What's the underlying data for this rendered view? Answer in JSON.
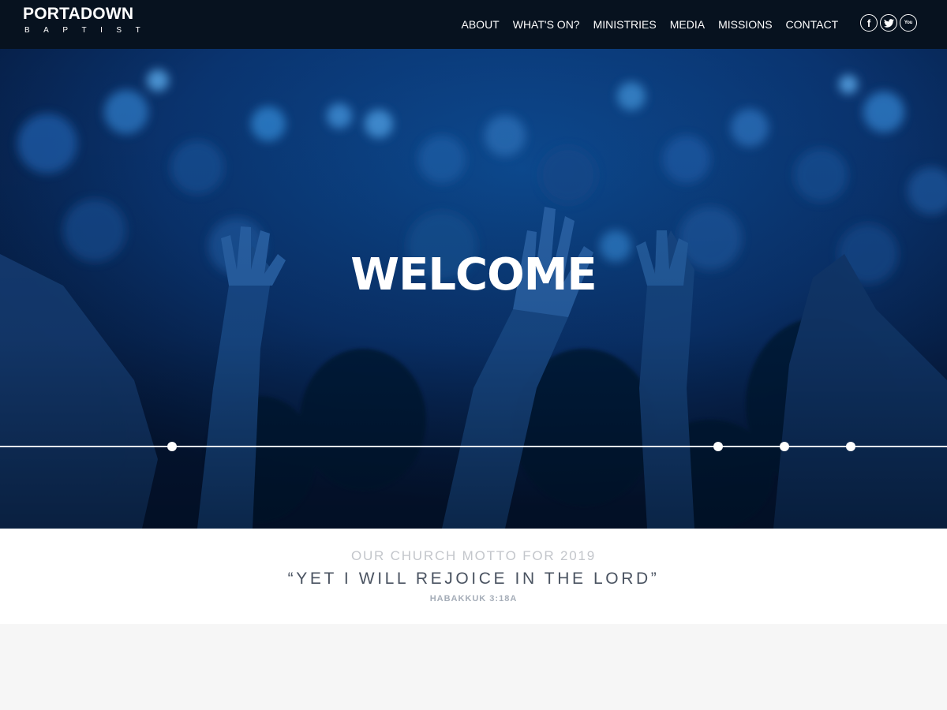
{
  "header": {
    "logo_main": "PORTADOWN",
    "logo_sub": "BAPTIST",
    "nav": [
      {
        "label": "ABOUT"
      },
      {
        "label": "WHAT'S ON?"
      },
      {
        "label": "MINISTRIES"
      },
      {
        "label": "MEDIA"
      },
      {
        "label": "MISSIONS"
      },
      {
        "label": "CONTACT"
      }
    ],
    "social": [
      {
        "icon": "facebook-icon",
        "glyph": "f"
      },
      {
        "icon": "twitter-icon"
      },
      {
        "icon": "youtube-icon",
        "glyph": "You"
      }
    ]
  },
  "hero": {
    "title": "WELCOME",
    "slides": 4
  },
  "motto": {
    "heading": "OUR CHURCH MOTTO FOR 2019",
    "quote": "“YET I WILL REJOICE IN THE LORD”",
    "reference": "HABAKKUK 3:18A"
  },
  "colors": {
    "header_bg": "#07121f",
    "hero_tint": "#0a2a58",
    "motto_heading": "#c3c6cb",
    "motto_quote": "#4a5361",
    "motto_ref": "#a5adb8",
    "page_bg": "#f6f6f6"
  }
}
